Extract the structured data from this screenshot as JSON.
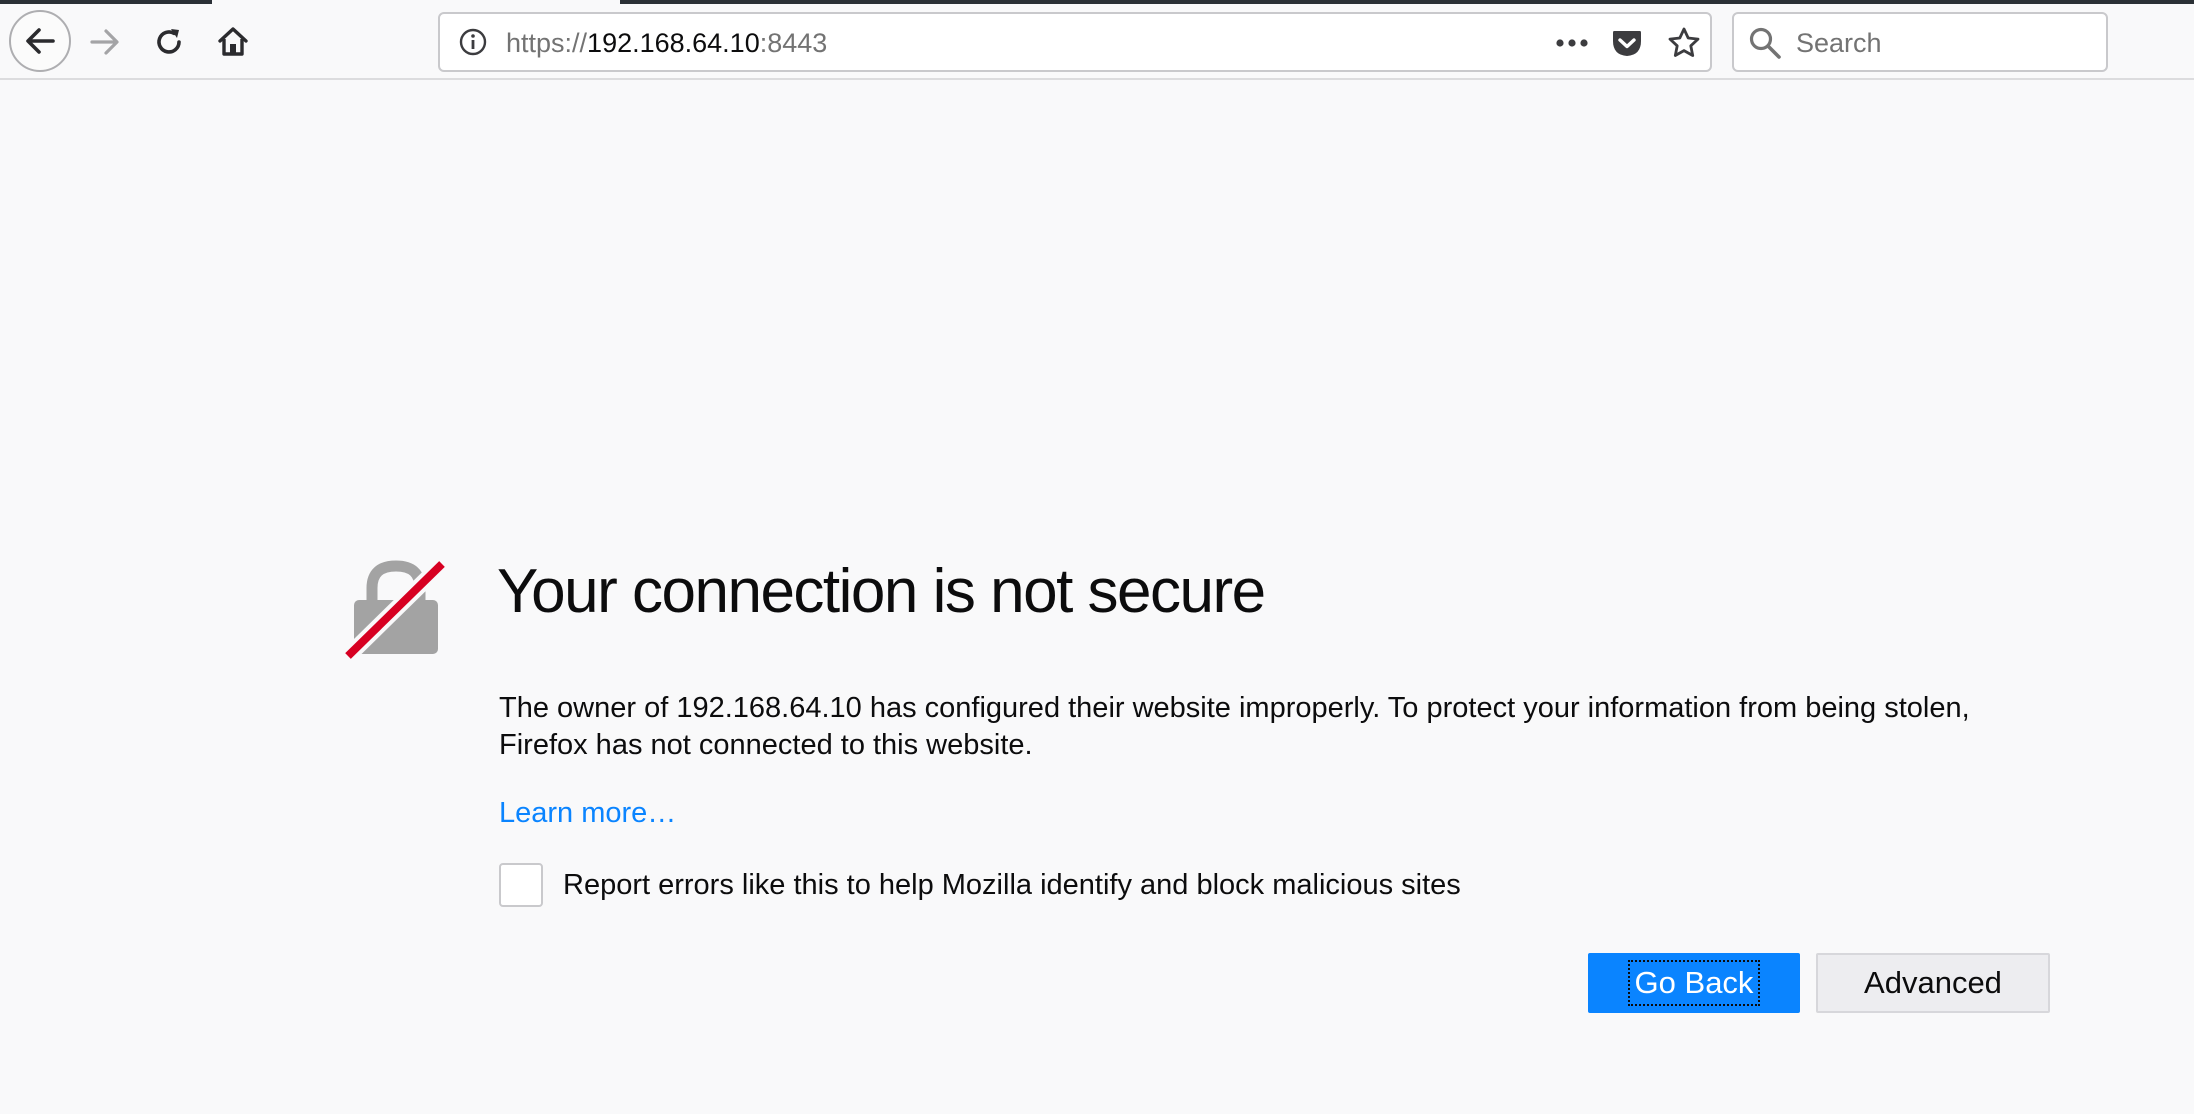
{
  "browser": {
    "url": {
      "scheme": "https://",
      "host": "192.168.64.10",
      "port": ":8443"
    },
    "search": {
      "placeholder": "Search"
    },
    "icons": {
      "back": "back-arrow-icon",
      "forward": "forward-arrow-icon",
      "reload": "reload-icon",
      "home": "home-icon",
      "site_info": "info-icon",
      "page_actions": "more-dots-icon",
      "pocket": "pocket-icon",
      "bookmark": "star-icon",
      "search": "search-icon"
    }
  },
  "error_page": {
    "icon": "broken-lock-icon",
    "title": "Your connection is not secure",
    "description": "The owner of 192.168.64.10 has configured their website improperly. To protect your information from being stolen, Firefox has not connected to this website.",
    "learn_more": "Learn more…",
    "report_label": "Report errors like this to help Mozilla identify and block malicious sites",
    "report_checked": false,
    "go_back_label": "Go Back",
    "advanced_label": "Advanced"
  },
  "colors": {
    "accent": "#0a84ff",
    "lock_gray": "#a3a3a3",
    "slash_red": "#d70022",
    "background": "#f9f9fa"
  }
}
